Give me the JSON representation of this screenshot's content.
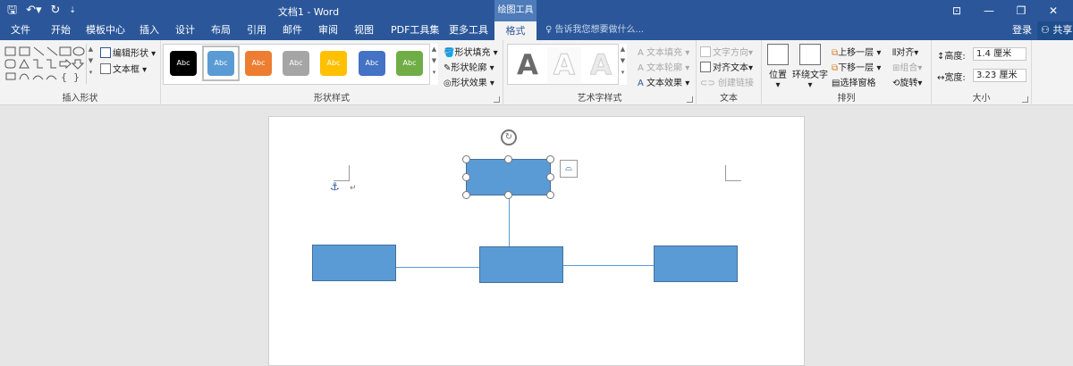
{
  "window": {
    "doc_title": "文档1 - Word",
    "context_title": "绘图工具"
  },
  "tabs": [
    {
      "label": "文件"
    },
    {
      "label": "开始"
    },
    {
      "label": "模板中心"
    },
    {
      "label": "插入"
    },
    {
      "label": "设计"
    },
    {
      "label": "布局"
    },
    {
      "label": "引用"
    },
    {
      "label": "邮件"
    },
    {
      "label": "审阅"
    },
    {
      "label": "视图"
    },
    {
      "label": "PDF工具集"
    },
    {
      "label": "更多工具"
    },
    {
      "label": "格式"
    }
  ],
  "tellme_placeholder": "告诉我您想要做什么...",
  "signin": "登录",
  "share": "共享",
  "ribbon": {
    "insert_shapes": {
      "label": "插入形状",
      "edit_shape": "编辑形状",
      "text_box": "文本框"
    },
    "shape_styles": {
      "label": "形状样式",
      "swatches": [
        {
          "text": "Abc",
          "color": "#000000"
        },
        {
          "text": "Abc",
          "color": "#5b9bd5"
        },
        {
          "text": "Abc",
          "color": "#ed7d31"
        },
        {
          "text": "Abc",
          "color": "#a5a5a5"
        },
        {
          "text": "Abc",
          "color": "#ffc000"
        },
        {
          "text": "Abc",
          "color": "#4472c4"
        },
        {
          "text": "Abc",
          "color": "#70ad47"
        }
      ],
      "fill": "形状填充",
      "outline": "形状轮廓",
      "effects": "形状效果"
    },
    "wordart": {
      "label": "艺术字样式",
      "letters": [
        "A",
        "A",
        "A"
      ],
      "text_fill": "文本填充",
      "text_outline": "文本轮廓",
      "text_effects": "文本效果"
    },
    "text": {
      "label": "文本",
      "direction": "文字方向",
      "align": "对齐文本",
      "link": "创建链接"
    },
    "arrange": {
      "label": "排列",
      "position": "位置",
      "wrap": "环绕文字",
      "bring_forward": "上移一层",
      "send_backward": "下移一层",
      "selection_pane": "选择窗格",
      "align": "对齐",
      "group": "组合",
      "rotate": "旋转"
    },
    "size": {
      "label": "大小",
      "height_label": "高度:",
      "height_value": "1.4 厘米",
      "width_label": "宽度:",
      "width_value": "3.23 厘米"
    }
  }
}
